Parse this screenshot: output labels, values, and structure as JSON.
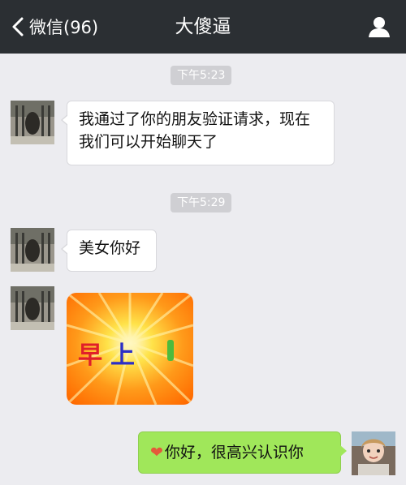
{
  "header": {
    "back_label": "微信(96)",
    "title": "大傻逼"
  },
  "timestamps": [
    "下午5:23",
    "下午5:29"
  ],
  "messages": {
    "msg1": "我通过了你的朋友验证请求，现在我们可以开始聊天了",
    "msg2": "美女你好",
    "sticker_text_1": "早",
    "sticker_text_2": "上",
    "msg_self": "你好，很高兴认识你"
  },
  "colors": {
    "header_bg": "#2b2f33",
    "chat_bg": "#ececf0",
    "self_bubble": "#a0e75a"
  },
  "icons": [
    "chevron-left-icon",
    "profile-icon",
    "heart-emoji-icon"
  ]
}
